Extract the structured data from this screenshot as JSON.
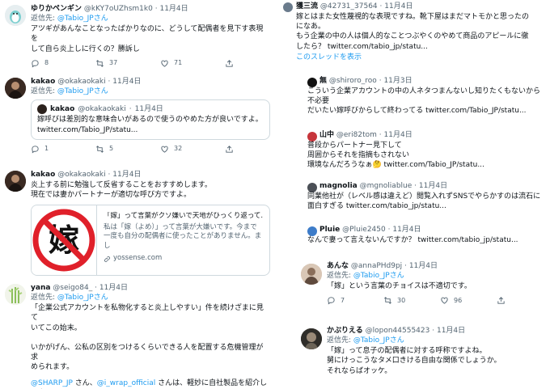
{
  "colors": {
    "accent": "#1d9bf0",
    "secondary_text": "#536471",
    "border": "#cfd9de"
  },
  "left": [
    {
      "name": "ゆりかペンギン",
      "handle": "@kKY7oUZhsm1k0",
      "date": "11月4日",
      "reply_prefix": "返信先: ",
      "reply_to": "@Tabio_JPさん",
      "text": "アツギがあんなことなったばかりなのに、どうして配偶者を見下す表現を\nして自ら炎上しに行くの？勝訴し",
      "replies": "8",
      "retweets": "37",
      "likes": "71"
    },
    {
      "name": "kakao",
      "handle": "@okakaokaki",
      "date": "11月4日",
      "reply_prefix": "返信先: ",
      "reply_to": "@Tabio_JPさん",
      "quote": {
        "name": "kakao",
        "handle": "@okakaokaki",
        "date": "11月4日",
        "text": "嫁呼びは差別的な意味合いがあるので使うのやめた方が良いですよ。\ntwitter.com/Tabio_JP/statu..."
      },
      "replies": "1",
      "retweets": "5",
      "likes": "32"
    },
    {
      "name": "kakao",
      "handle": "@okakaokaki",
      "date": "11月4日",
      "text": "炎上する前に勉強して反省することをおすすめします。\n現在では妻かパートナーが適切な呼び方ですよ。",
      "card": {
        "image_glyph": "嫁",
        "title": "「嫁」って言葉がクソ嫌いで天地がひっくり返って...",
        "desc": "私は「嫁（よめ）」って言葉が大嫌いです。今まで一度も自分の配偶者に使ったことがありません。まし",
        "domain": "yossense.com"
      }
    },
    {
      "name": "yana",
      "handle": "@seigo84_",
      "date": "11月4日",
      "reply_prefix": "返信先: ",
      "reply_to": "@Tabio_JPさん",
      "text": "「企業公式アカウントを私物化すると炎上しやすい」件を続けざまに見て\nいてこの始末。\n\nいかがげん、公私の区別をつけるくらいできる人を配置する危機管理が求\nめられます。",
      "mention1": "@SHARP_JP",
      "mid1": " さん、",
      "mention2": "@i_wrap_official",
      "tail": " さんは、軽妙に自社製品を紹介してま\nす。中の人が勝ちすことも、出張などまです。"
    }
  ],
  "right": [
    {
      "name": "獲三流",
      "handle": "@42731_37564",
      "date": "11月4日",
      "text": "嫁とはまた女性蔑視的な表現ですね。靴下屋はまだマトモかと思ったの\nになあ。\nもう企業の中の人は個人的なことつぶやくのやめて商品のアピールに徹\nしたら？ twitter.com/tabio_jp/statu...",
      "show_thread": "このスレッドを表示"
    },
    {
      "name": "無",
      "handle": "@shiroro_roo",
      "date": "11月3日",
      "text": "こういう企業アカウントの中の人ネタつまんないし知りたくもないから\n不必要\nだいたい嫁呼びからして終わってる twitter.com/Tabio_JP/statu..."
    },
    {
      "name": "山中",
      "handle": "@eri82tom",
      "date": "11月4日",
      "text": "普段からパートナー見下して\n周囲からそれを指摘もされない\n環境なんだろうなぁ🤔 twitter.com/Tabio_JP/statu..."
    },
    {
      "name": "magnolia",
      "handle": "@mgnoliablue",
      "date": "11月4日",
      "text": "同業他社が（レベル感は違えど）閲覧入れずSNSでやらかすのは流石に\n面白すぎる twitter.com/tabio_jp/statu..."
    },
    {
      "name": "Pluie",
      "handle": "@Pluie2450",
      "date": "11月4日",
      "text": "なんで妻って言えないんですか？ twitter.com/tabio_jp/statu..."
    },
    {
      "name": "あんな",
      "handle": "@annaPHd9pj",
      "date": "11月4日",
      "reply_prefix": "返信先: ",
      "reply_to": "@Tabio_JPさん",
      "text": "「嫁」という言葉のチョイスは不適切です。",
      "replies": "7",
      "retweets": "30",
      "likes": "96"
    },
    {
      "name": "かぷりえる",
      "handle": "@lopon44555423",
      "date": "11月4日",
      "reply_prefix": "返信先: ",
      "reply_to": "@Tabio_JPさん",
      "text": "「嫁」って息子の配偶者に対する呼称ですよね。\n舅にけっこうなタメ口きける自由な関係でしょうか。\nそれならばオッケ。"
    }
  ]
}
